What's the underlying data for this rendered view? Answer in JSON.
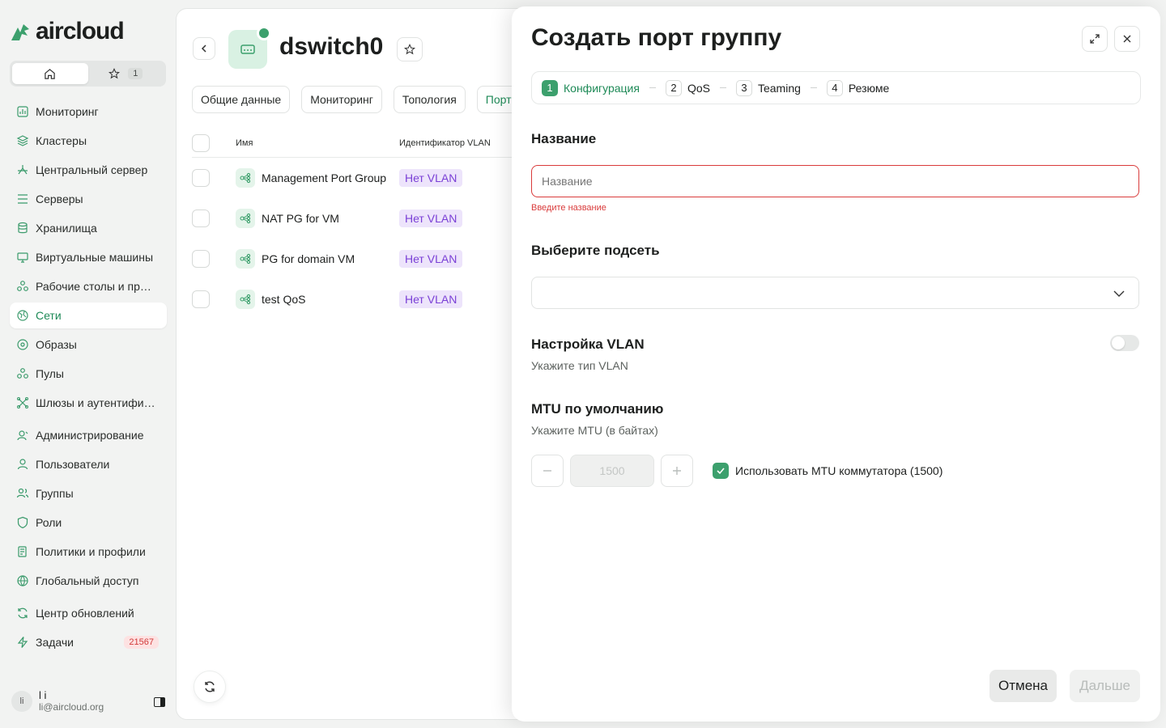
{
  "brand": {
    "name": "aircloud"
  },
  "favorites": {
    "count": "1"
  },
  "sidebar": {
    "items": [
      {
        "label": "Мониторинг",
        "icon": "chart-icon"
      },
      {
        "label": "Кластеры",
        "icon": "layers-icon"
      },
      {
        "label": "Центральный сервер",
        "icon": "hierarchy-icon"
      },
      {
        "label": "Серверы",
        "icon": "server-icon"
      },
      {
        "label": "Хранилища",
        "icon": "database-icon"
      },
      {
        "label": "Виртуальные машины",
        "icon": "monitor-icon"
      },
      {
        "label": "Рабочие столы и прил...",
        "icon": "apps-icon"
      },
      {
        "label": "Сети",
        "icon": "network-icon"
      },
      {
        "label": "Образы",
        "icon": "disc-icon"
      },
      {
        "label": "Пулы",
        "icon": "pool-icon"
      },
      {
        "label": "Шлюзы и аутентифика...",
        "icon": "gateway-icon"
      },
      {
        "label": "Администрирование",
        "icon": "admin-icon"
      },
      {
        "label": "Пользователи",
        "icon": "user-icon"
      },
      {
        "label": "Группы",
        "icon": "group-icon"
      },
      {
        "label": "Роли",
        "icon": "shield-icon"
      },
      {
        "label": "Политики и профили",
        "icon": "policy-icon"
      },
      {
        "label": "Глобальный доступ",
        "icon": "globe-icon"
      },
      {
        "label": "Центр обновлений",
        "icon": "refresh-icon"
      },
      {
        "label": "Задачи",
        "icon": "bolt-icon",
        "badge": "21567"
      }
    ],
    "active_index": 7
  },
  "user": {
    "name": "l i",
    "initials": "li",
    "email": "li@aircloud.org"
  },
  "page": {
    "title": "dswitch0",
    "tabs": [
      "Общие данные",
      "Мониторинг",
      "Топология",
      "Порт г"
    ],
    "table": {
      "headers": {
        "name": "Имя",
        "vlan": "Идентификатор VLAN"
      },
      "rows": [
        {
          "name": "Management Port Group",
          "vlan": "Нет VLAN"
        },
        {
          "name": "NAT PG for VM",
          "vlan": "Нет VLAN"
        },
        {
          "name": "PG for domain VM",
          "vlan": "Нет VLAN"
        },
        {
          "name": "test QoS",
          "vlan": "Нет VLAN"
        }
      ]
    }
  },
  "drawer": {
    "title": "Создать порт группу",
    "steps": [
      {
        "num": "1",
        "label": "Конфигурация"
      },
      {
        "num": "2",
        "label": "QoS"
      },
      {
        "num": "3",
        "label": "Teaming"
      },
      {
        "num": "4",
        "label": "Резюме"
      }
    ],
    "active_step": 0,
    "name_section": {
      "title": "Название",
      "placeholder": "Название",
      "value": "",
      "error": "Введите название"
    },
    "subnet_section": {
      "title": "Выберите подсеть",
      "value": ""
    },
    "vlan_section": {
      "title": "Настройка VLAN",
      "subtitle": "Укажите тип VLAN",
      "enabled": false
    },
    "mtu_section": {
      "title": "MTU по умолчанию",
      "subtitle": "Укажите MTU (в байтах)",
      "value": "1500",
      "use_switch_label": "Использовать MTU коммутатора (1500)",
      "use_switch_checked": true
    },
    "buttons": {
      "cancel": "Отмена",
      "next": "Дальше"
    }
  },
  "colors": {
    "accent": "#3ca06d",
    "error": "#d93b3b",
    "vlan_badge": "#7a3fd6"
  }
}
